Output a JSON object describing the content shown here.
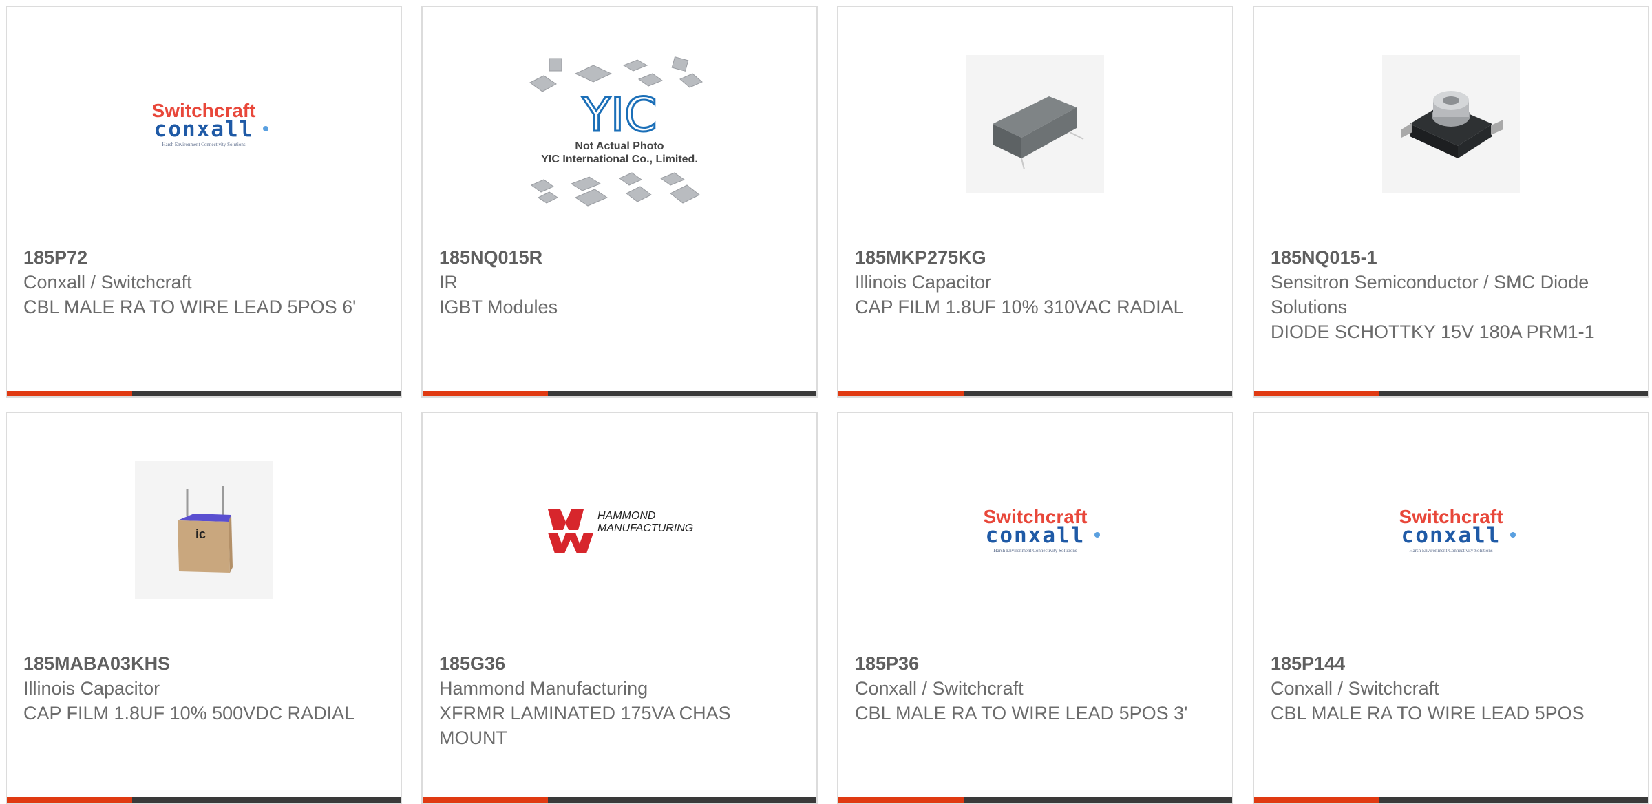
{
  "colors": {
    "accent": "#e03a12",
    "bar": "#3a3a3a",
    "border": "#dcdcdc",
    "text": "#6b6b6b"
  },
  "products": [
    {
      "part": "185P72",
      "maker": "Conxall / Switchcraft",
      "desc": "CBL MALE RA TO WIRE LEAD 5POS 6'",
      "image": "switchcraft-conxall-logo",
      "logo": {
        "top": "Switchcraft",
        "bottom": "conxall",
        "tag": "Harsh Environment Connectivity Solutions"
      }
    },
    {
      "part": "185NQ015R",
      "maker": "IR",
      "desc": "IGBT Modules",
      "image": "yic-placeholder",
      "placeholder": {
        "brand": "YIC",
        "line1": "Not Actual Photo",
        "line2": "YIC International Co., Limited."
      }
    },
    {
      "part": "185MKP275KG",
      "maker": "Illinois Capacitor",
      "desc": "CAP FILM 1.8UF 10% 310VAC RADIAL",
      "image": "film-capacitor-photo"
    },
    {
      "part": "185NQ015-1",
      "maker": "Sensitron Semiconductor / SMC Diode Solutions",
      "desc": "DIODE SCHOTTKY 15V 180A PRM1-1",
      "image": "diode-module-photo"
    },
    {
      "part": "185MABA03KHS",
      "maker": "Illinois Capacitor",
      "desc": "CAP FILM 1.8UF 10% 500VDC RADIAL",
      "image": "box-capacitor-photo"
    },
    {
      "part": "185G36",
      "maker": "Hammond Manufacturing",
      "desc": "XFRMR LAMINATED 175VA CHAS MOUNT",
      "image": "hammond-logo",
      "logo": {
        "line1": "HAMMOND",
        "line2": "MANUFACTURING"
      }
    },
    {
      "part": "185P36",
      "maker": "Conxall / Switchcraft",
      "desc": "CBL MALE RA TO WIRE LEAD 5POS 3'",
      "image": "switchcraft-conxall-logo",
      "logo": {
        "top": "Switchcraft",
        "bottom": "conxall",
        "tag": "Harsh Environment Connectivity Solutions"
      }
    },
    {
      "part": "185P144",
      "maker": "Conxall / Switchcraft",
      "desc": "CBL MALE RA TO WIRE LEAD 5POS",
      "image": "switchcraft-conxall-logo",
      "logo": {
        "top": "Switchcraft",
        "bottom": "conxall",
        "tag": "Harsh Environment Connectivity Solutions"
      }
    }
  ]
}
